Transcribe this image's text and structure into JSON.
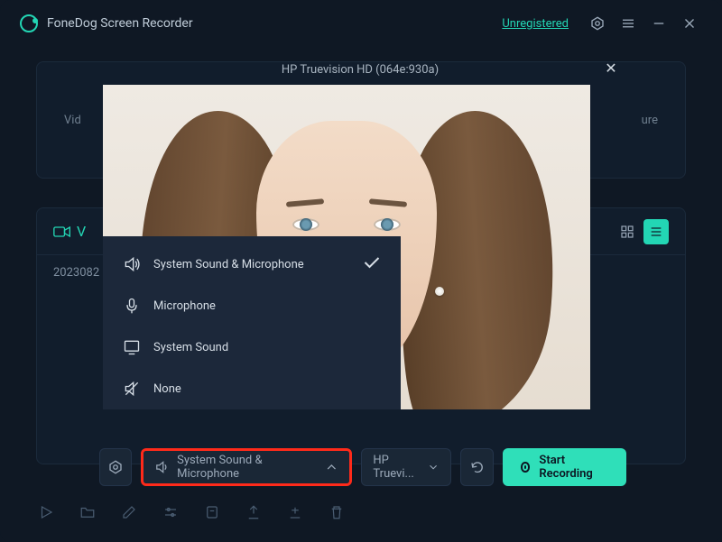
{
  "titlebar": {
    "app_name": "FoneDog Screen Recorder",
    "register_link": "Unregistered"
  },
  "bg_top": {
    "left_tab": "Vid",
    "right_tab": "ure"
  },
  "mid_panel": {
    "tab_label": "V",
    "file_name": "2023082"
  },
  "modal": {
    "camera_title": "HP Truevision HD (064e:930a)",
    "audio_options": [
      {
        "label": "System Sound & Microphone",
        "selected": true
      },
      {
        "label": "Microphone",
        "selected": false
      },
      {
        "label": "System Sound",
        "selected": false
      },
      {
        "label": "None",
        "selected": false
      }
    ],
    "controls": {
      "audio_selected": "System Sound & Microphone",
      "camera_selected": "HP Truevi...",
      "start_label": "Start Recording"
    }
  }
}
